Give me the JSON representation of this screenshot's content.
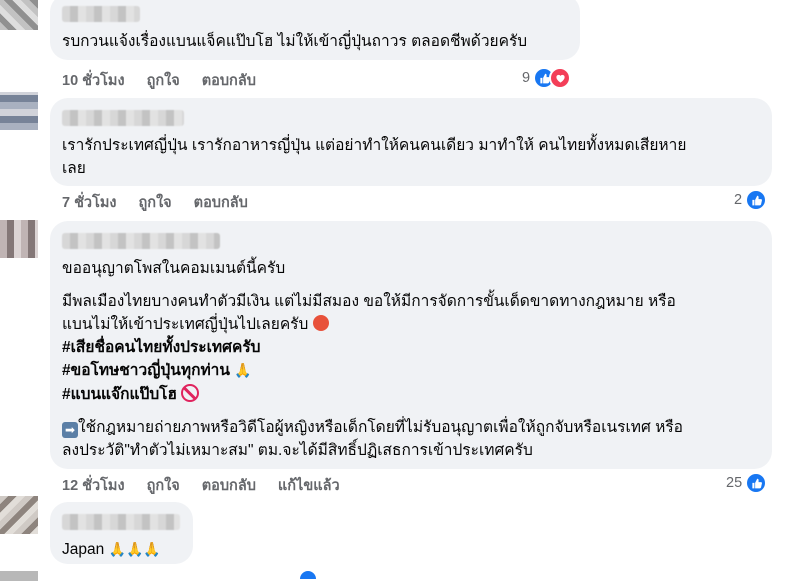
{
  "comments": [
    {
      "text": "รบกวนแจ้งเรื่องแบนแจ็คแป๊บโฮ ไม่ให้เข้าญี่ปุ่นถาวร ตลอดชีพด้วยครับ",
      "time": "10 ชั่วโมง",
      "like_label": "ถูกใจ",
      "reply_label": "ตอบกลับ",
      "reaction_count": "9"
    },
    {
      "text_line1": "เรารักประเทศญี่ปุ่น เรารักอาหารญี่ปุ่น แต่อย่าทำให้คนคนเดียว มาทำให้ คนไทยทั้งหมดเสียหาย",
      "text_line2": "เลย",
      "time": "7 ชั่วโมง",
      "like_label": "ถูกใจ",
      "reply_label": "ตอบกลับ",
      "reaction_count": "2"
    },
    {
      "line_permission": "ขออนุญาตโพสในคอมเมนต์นี้ครับ",
      "line_a1": "มีพลเมืองไทยบางคนทำตัวมีเงิน แต่ไม่มีสมอง ขอให้มีการจัดการขั้นเด็ดขาดทางกฎหมาย หรือ",
      "line_a2": "แบนไม่ให้เข้าประเทศญี่ปุ่นไปเลยครับ",
      "hashtag1": "#เสียชื่อคนไทยทั้งประเทศครับ",
      "hashtag2": "#ขอโทษชาวญี่ปุ่นทุกท่าน",
      "hashtag3": "#แบนแจ๊กแป๊บโฮ",
      "line_b1": "ใช้กฎหมายถ่ายภาพหรือวิดีโอผู้หญิงหรือเด็กโดยที่ไม่รับอนุญาตเพื่อให้ถูกจับหรือเนรเทศ หรือ",
      "line_b2": "ลงประวัติ\"ทำตัวไม่เหมาะสม\" ตม.จะได้มีสิทธิ์ปฏิเสธการเข้าประเทศครับ",
      "time": "12 ชั่วโมง",
      "like_label": "ถูกใจ",
      "reply_label": "ตอบกลับ",
      "edited_label": "แก้ไขแล้ว",
      "reaction_count": "25"
    },
    {
      "text": "Japan",
      "emoji": "🙏🙏🙏"
    }
  ],
  "icons": {
    "like": "like-icon",
    "love": "love-icon",
    "angry": "angry-face-icon",
    "pray": "pray-icon",
    "no": "prohibited-icon",
    "arrow": "right-arrow-icon"
  },
  "colors": {
    "bubble": "#f0f2f5",
    "meta_text": "#65676b",
    "like_blue": "#1877f2",
    "love_red": "#f33e58"
  }
}
